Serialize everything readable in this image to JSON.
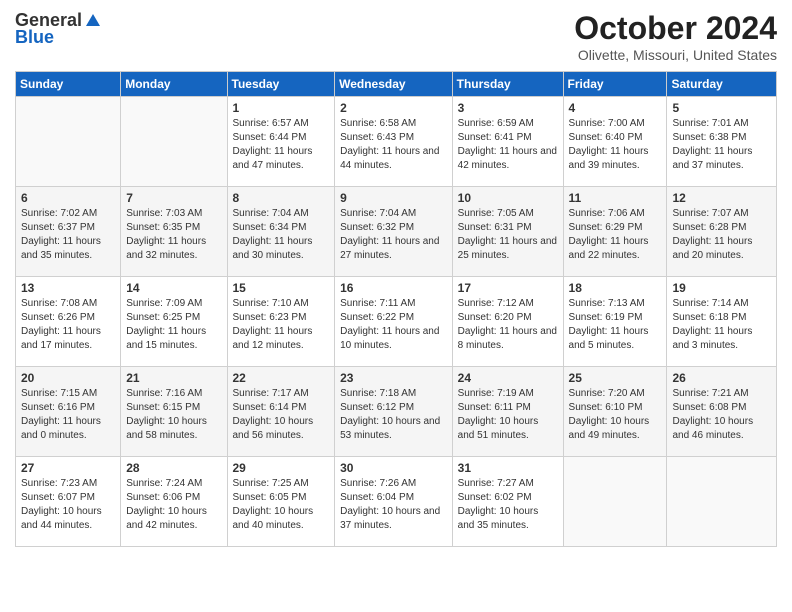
{
  "header": {
    "logo_general": "General",
    "logo_blue": "Blue",
    "month_title": "October 2024",
    "location": "Olivette, Missouri, United States"
  },
  "weekdays": [
    "Sunday",
    "Monday",
    "Tuesday",
    "Wednesday",
    "Thursday",
    "Friday",
    "Saturday"
  ],
  "weeks": [
    [
      {
        "day": "",
        "sunrise": "",
        "sunset": "",
        "daylight": ""
      },
      {
        "day": "",
        "sunrise": "",
        "sunset": "",
        "daylight": ""
      },
      {
        "day": "1",
        "sunrise": "Sunrise: 6:57 AM",
        "sunset": "Sunset: 6:44 PM",
        "daylight": "Daylight: 11 hours and 47 minutes."
      },
      {
        "day": "2",
        "sunrise": "Sunrise: 6:58 AM",
        "sunset": "Sunset: 6:43 PM",
        "daylight": "Daylight: 11 hours and 44 minutes."
      },
      {
        "day": "3",
        "sunrise": "Sunrise: 6:59 AM",
        "sunset": "Sunset: 6:41 PM",
        "daylight": "Daylight: 11 hours and 42 minutes."
      },
      {
        "day": "4",
        "sunrise": "Sunrise: 7:00 AM",
        "sunset": "Sunset: 6:40 PM",
        "daylight": "Daylight: 11 hours and 39 minutes."
      },
      {
        "day": "5",
        "sunrise": "Sunrise: 7:01 AM",
        "sunset": "Sunset: 6:38 PM",
        "daylight": "Daylight: 11 hours and 37 minutes."
      }
    ],
    [
      {
        "day": "6",
        "sunrise": "Sunrise: 7:02 AM",
        "sunset": "Sunset: 6:37 PM",
        "daylight": "Daylight: 11 hours and 35 minutes."
      },
      {
        "day": "7",
        "sunrise": "Sunrise: 7:03 AM",
        "sunset": "Sunset: 6:35 PM",
        "daylight": "Daylight: 11 hours and 32 minutes."
      },
      {
        "day": "8",
        "sunrise": "Sunrise: 7:04 AM",
        "sunset": "Sunset: 6:34 PM",
        "daylight": "Daylight: 11 hours and 30 minutes."
      },
      {
        "day": "9",
        "sunrise": "Sunrise: 7:04 AM",
        "sunset": "Sunset: 6:32 PM",
        "daylight": "Daylight: 11 hours and 27 minutes."
      },
      {
        "day": "10",
        "sunrise": "Sunrise: 7:05 AM",
        "sunset": "Sunset: 6:31 PM",
        "daylight": "Daylight: 11 hours and 25 minutes."
      },
      {
        "day": "11",
        "sunrise": "Sunrise: 7:06 AM",
        "sunset": "Sunset: 6:29 PM",
        "daylight": "Daylight: 11 hours and 22 minutes."
      },
      {
        "day": "12",
        "sunrise": "Sunrise: 7:07 AM",
        "sunset": "Sunset: 6:28 PM",
        "daylight": "Daylight: 11 hours and 20 minutes."
      }
    ],
    [
      {
        "day": "13",
        "sunrise": "Sunrise: 7:08 AM",
        "sunset": "Sunset: 6:26 PM",
        "daylight": "Daylight: 11 hours and 17 minutes."
      },
      {
        "day": "14",
        "sunrise": "Sunrise: 7:09 AM",
        "sunset": "Sunset: 6:25 PM",
        "daylight": "Daylight: 11 hours and 15 minutes."
      },
      {
        "day": "15",
        "sunrise": "Sunrise: 7:10 AM",
        "sunset": "Sunset: 6:23 PM",
        "daylight": "Daylight: 11 hours and 12 minutes."
      },
      {
        "day": "16",
        "sunrise": "Sunrise: 7:11 AM",
        "sunset": "Sunset: 6:22 PM",
        "daylight": "Daylight: 11 hours and 10 minutes."
      },
      {
        "day": "17",
        "sunrise": "Sunrise: 7:12 AM",
        "sunset": "Sunset: 6:20 PM",
        "daylight": "Daylight: 11 hours and 8 minutes."
      },
      {
        "day": "18",
        "sunrise": "Sunrise: 7:13 AM",
        "sunset": "Sunset: 6:19 PM",
        "daylight": "Daylight: 11 hours and 5 minutes."
      },
      {
        "day": "19",
        "sunrise": "Sunrise: 7:14 AM",
        "sunset": "Sunset: 6:18 PM",
        "daylight": "Daylight: 11 hours and 3 minutes."
      }
    ],
    [
      {
        "day": "20",
        "sunrise": "Sunrise: 7:15 AM",
        "sunset": "Sunset: 6:16 PM",
        "daylight": "Daylight: 11 hours and 0 minutes."
      },
      {
        "day": "21",
        "sunrise": "Sunrise: 7:16 AM",
        "sunset": "Sunset: 6:15 PM",
        "daylight": "Daylight: 10 hours and 58 minutes."
      },
      {
        "day": "22",
        "sunrise": "Sunrise: 7:17 AM",
        "sunset": "Sunset: 6:14 PM",
        "daylight": "Daylight: 10 hours and 56 minutes."
      },
      {
        "day": "23",
        "sunrise": "Sunrise: 7:18 AM",
        "sunset": "Sunset: 6:12 PM",
        "daylight": "Daylight: 10 hours and 53 minutes."
      },
      {
        "day": "24",
        "sunrise": "Sunrise: 7:19 AM",
        "sunset": "Sunset: 6:11 PM",
        "daylight": "Daylight: 10 hours and 51 minutes."
      },
      {
        "day": "25",
        "sunrise": "Sunrise: 7:20 AM",
        "sunset": "Sunset: 6:10 PM",
        "daylight": "Daylight: 10 hours and 49 minutes."
      },
      {
        "day": "26",
        "sunrise": "Sunrise: 7:21 AM",
        "sunset": "Sunset: 6:08 PM",
        "daylight": "Daylight: 10 hours and 46 minutes."
      }
    ],
    [
      {
        "day": "27",
        "sunrise": "Sunrise: 7:23 AM",
        "sunset": "Sunset: 6:07 PM",
        "daylight": "Daylight: 10 hours and 44 minutes."
      },
      {
        "day": "28",
        "sunrise": "Sunrise: 7:24 AM",
        "sunset": "Sunset: 6:06 PM",
        "daylight": "Daylight: 10 hours and 42 minutes."
      },
      {
        "day": "29",
        "sunrise": "Sunrise: 7:25 AM",
        "sunset": "Sunset: 6:05 PM",
        "daylight": "Daylight: 10 hours and 40 minutes."
      },
      {
        "day": "30",
        "sunrise": "Sunrise: 7:26 AM",
        "sunset": "Sunset: 6:04 PM",
        "daylight": "Daylight: 10 hours and 37 minutes."
      },
      {
        "day": "31",
        "sunrise": "Sunrise: 7:27 AM",
        "sunset": "Sunset: 6:02 PM",
        "daylight": "Daylight: 10 hours and 35 minutes."
      },
      {
        "day": "",
        "sunrise": "",
        "sunset": "",
        "daylight": ""
      },
      {
        "day": "",
        "sunrise": "",
        "sunset": "",
        "daylight": ""
      }
    ]
  ]
}
